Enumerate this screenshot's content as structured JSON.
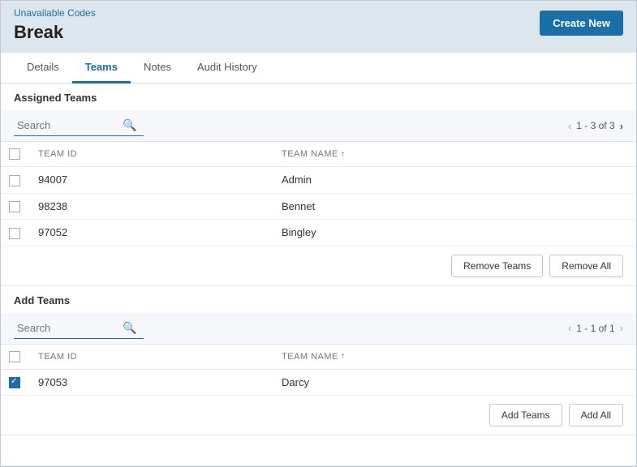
{
  "header": {
    "breadcrumb": "Unavailable Codes",
    "title": "Break",
    "create_new_label": "Create New"
  },
  "tabs": [
    {
      "id": "details",
      "label": "Details",
      "active": false
    },
    {
      "id": "teams",
      "label": "Teams",
      "active": true
    },
    {
      "id": "notes",
      "label": "Notes",
      "active": false
    },
    {
      "id": "audit_history",
      "label": "Audit History",
      "active": false
    }
  ],
  "assigned_teams": {
    "section_title": "Assigned Teams",
    "search_placeholder": "Search",
    "pagination": "1 - 3 of 3",
    "columns": [
      {
        "id": "team_id",
        "label": "TEAM ID"
      },
      {
        "id": "team_name",
        "label": "TEAM NAME"
      }
    ],
    "rows": [
      {
        "id": "94007",
        "name": "Admin"
      },
      {
        "id": "98238",
        "name": "Bennet"
      },
      {
        "id": "97052",
        "name": "Bingley"
      }
    ],
    "remove_teams_label": "Remove Teams",
    "remove_all_label": "Remove All"
  },
  "add_teams": {
    "section_title": "Add Teams",
    "search_placeholder": "Search",
    "pagination": "1 - 1 of 1",
    "columns": [
      {
        "id": "team_id",
        "label": "TEAM ID"
      },
      {
        "id": "team_name",
        "label": "TEAM NAME"
      }
    ],
    "rows": [
      {
        "id": "97053",
        "name": "Darcy",
        "checked": true
      }
    ],
    "add_teams_label": "Add Teams",
    "add_all_label": "Add All"
  }
}
